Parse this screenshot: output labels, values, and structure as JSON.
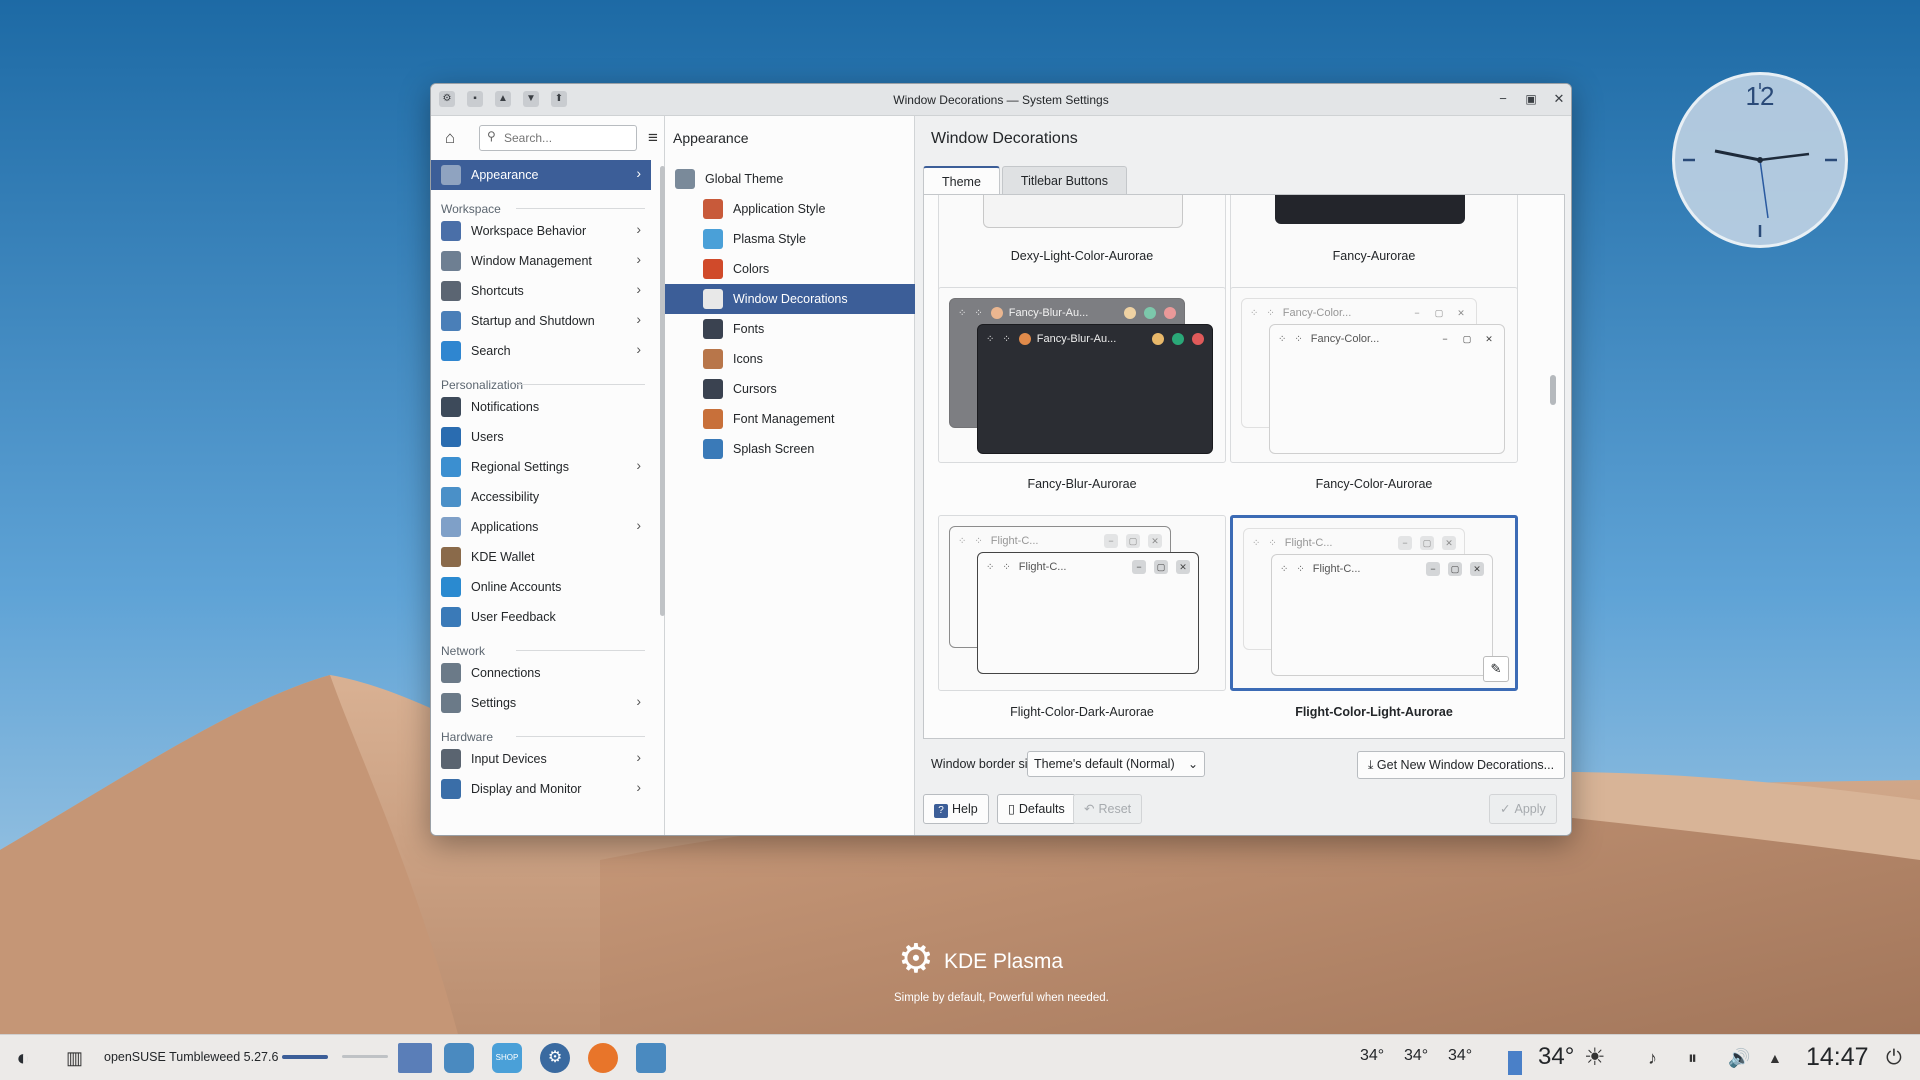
{
  "window": {
    "title": "Window Decorations — System Settings"
  },
  "sidebar": {
    "search_placeholder": "Search...",
    "selected": {
      "label": "Appearance"
    },
    "sections": [
      {
        "title": "Workspace",
        "items": [
          {
            "label": "Workspace Behavior",
            "chevron": true,
            "color": "#4a6fa8"
          },
          {
            "label": "Window Management",
            "chevron": true,
            "color": "#6e7f92"
          },
          {
            "label": "Shortcuts",
            "chevron": true,
            "color": "#5b6572"
          },
          {
            "label": "Startup and Shutdown",
            "chevron": true,
            "color": "#4a7fb8"
          },
          {
            "label": "Search",
            "chevron": true,
            "color": "#2f86d0"
          }
        ]
      },
      {
        "title": "Personalization",
        "items": [
          {
            "label": "Notifications",
            "chevron": false,
            "color": "#3d4a5a"
          },
          {
            "label": "Users",
            "chevron": false,
            "color": "#2a6cb0"
          },
          {
            "label": "Regional Settings",
            "chevron": true,
            "color": "#3b8fd0"
          },
          {
            "label": "Accessibility",
            "chevron": false,
            "color": "#4a90c8"
          },
          {
            "label": "Applications",
            "chevron": true,
            "color": "#7fa0c8"
          },
          {
            "label": "KDE Wallet",
            "chevron": false,
            "color": "#8a6a4a"
          },
          {
            "label": "Online Accounts",
            "chevron": false,
            "color": "#2a8ad0"
          },
          {
            "label": "User Feedback",
            "chevron": false,
            "color": "#3a7ab8"
          }
        ]
      },
      {
        "title": "Network",
        "items": [
          {
            "label": "Connections",
            "chevron": false,
            "color": "#6b7a88"
          },
          {
            "label": "Settings",
            "chevron": true,
            "color": "#6b7a88"
          }
        ]
      },
      {
        "title": "Hardware",
        "items": [
          {
            "label": "Input Devices",
            "chevron": true,
            "color": "#5a6470"
          },
          {
            "label": "Display and Monitor",
            "chevron": true,
            "color": "#3a6ea8"
          }
        ]
      }
    ]
  },
  "subpanel": {
    "title": "Appearance",
    "items": [
      {
        "label": "Global Theme",
        "indent": false,
        "selected": false,
        "color": "#7a8a9a"
      },
      {
        "label": "Application Style",
        "indent": true,
        "selected": false,
        "color": "#c85a3a"
      },
      {
        "label": "Plasma Style",
        "indent": true,
        "selected": false,
        "color": "#4aa0d8"
      },
      {
        "label": "Colors",
        "indent": true,
        "selected": false,
        "color": "#d04a2a"
      },
      {
        "label": "Window Decorations",
        "indent": true,
        "selected": true,
        "color": "#e8e8e8"
      },
      {
        "label": "Fonts",
        "indent": true,
        "selected": false,
        "color": "#3a4250"
      },
      {
        "label": "Icons",
        "indent": true,
        "selected": false,
        "color": "#b8764a"
      },
      {
        "label": "Cursors",
        "indent": true,
        "selected": false,
        "color": "#3a4250"
      },
      {
        "label": "Font Management",
        "indent": true,
        "selected": false,
        "color": "#c8703a"
      },
      {
        "label": "Splash Screen",
        "indent": true,
        "selected": false,
        "color": "#3a7ab8"
      }
    ]
  },
  "content": {
    "title": "Window Decorations",
    "tabs": [
      "Theme",
      "Titlebar Buttons"
    ],
    "active_tab": "Theme",
    "cards": [
      {
        "label": "Dexy-Light-Color-Aurorae",
        "preview_title": "",
        "style": "light-partial"
      },
      {
        "label": "Fancy-Aurorae",
        "preview_title": "",
        "style": "dark-partial"
      },
      {
        "label": "Fancy-Blur-Aurorae",
        "preview_title": "Fancy-Blur-Au...",
        "style": "blur"
      },
      {
        "label": "Fancy-Color-Aurorae",
        "preview_title": "Fancy-Color...",
        "style": "color"
      },
      {
        "label": "Flight-Color-Dark-Aurorae",
        "preview_title": "Flight-C...",
        "style": "flight-dark"
      },
      {
        "label": "Flight-Color-Light-Aurorae",
        "preview_title": "Flight-C...",
        "style": "flight-light",
        "selected": true
      }
    ],
    "border_size_label": "Window border size:",
    "border_size_value": "Theme's default (Normal)",
    "get_new_label": "Get New Window Decorations...",
    "footer": {
      "help": "Help",
      "defaults": "Defaults",
      "reset": "Reset",
      "apply": "Apply"
    }
  },
  "desktop": {
    "kde_brand": "KDE Plasma",
    "kde_tagline": "Simple by default, Powerful when needed.",
    "clock_number": "12"
  },
  "taskbar": {
    "distro_label": "openSUSE Tumbleweed 5.27.6",
    "temps": [
      "34°",
      "34°",
      "34°"
    ],
    "weather_temp": "34°",
    "time": "14:47"
  }
}
